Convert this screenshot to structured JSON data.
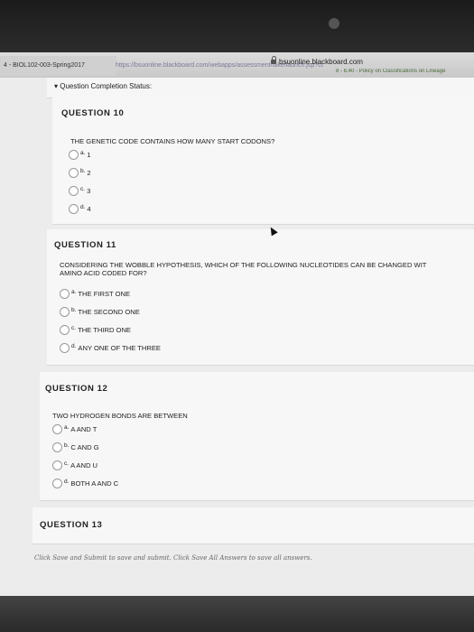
{
  "browser": {
    "tab_title": "4 - BIOL102-003-Spring2017",
    "tab_url": "https://bsuonline.blackboard.com/webapps/assessment/take/launch.jsp?course_assessment_id=_10443",
    "domain": "bsuonline.blackboard.com",
    "bookmark": "8 - 8.40 - Policy on Classifications on Lineage"
  },
  "status": {
    "label": "Question Completion Status:"
  },
  "questions": [
    {
      "title": "QUESTION 10",
      "text_line1": "THE GENETIC CODE CONTAINS HOW MANY START CODONS?",
      "text_line2": "",
      "options": [
        {
          "letter": "a.",
          "label": "1"
        },
        {
          "letter": "b.",
          "label": "2"
        },
        {
          "letter": "c.",
          "label": "3"
        },
        {
          "letter": "d.",
          "label": "4"
        }
      ]
    },
    {
      "title": "QUESTION 11",
      "text_line1": "CONSIDERING THE WOBBLE HYPOTHESIS, WHICH OF THE FOLLOWING NUCLEOTIDES CAN BE CHANGED WIT",
      "text_line2": "AMINO ACID CODED FOR?",
      "options": [
        {
          "letter": "a.",
          "label": "THE FIRST ONE"
        },
        {
          "letter": "b.",
          "label": "THE SECOND ONE"
        },
        {
          "letter": "c.",
          "label": "THE THIRD ONE"
        },
        {
          "letter": "d.",
          "label": "ANY ONE OF THE THREE"
        }
      ]
    },
    {
      "title": "QUESTION 12",
      "text_line1": "TWO HYDROGEN BONDS ARE BETWEEN",
      "text_line2": "",
      "options": [
        {
          "letter": "a.",
          "label": "A AND T"
        },
        {
          "letter": "b.",
          "label": "C AND G"
        },
        {
          "letter": "c.",
          "label": "A AND U"
        },
        {
          "letter": "d.",
          "label": "BOTH A AND C"
        }
      ]
    },
    {
      "title": "QUESTION 13",
      "text_line1": "",
      "text_line2": "",
      "options": []
    }
  ],
  "footer": {
    "note": "Click Save and Submit to save and submit. Click Save All Answers to save all answers."
  }
}
